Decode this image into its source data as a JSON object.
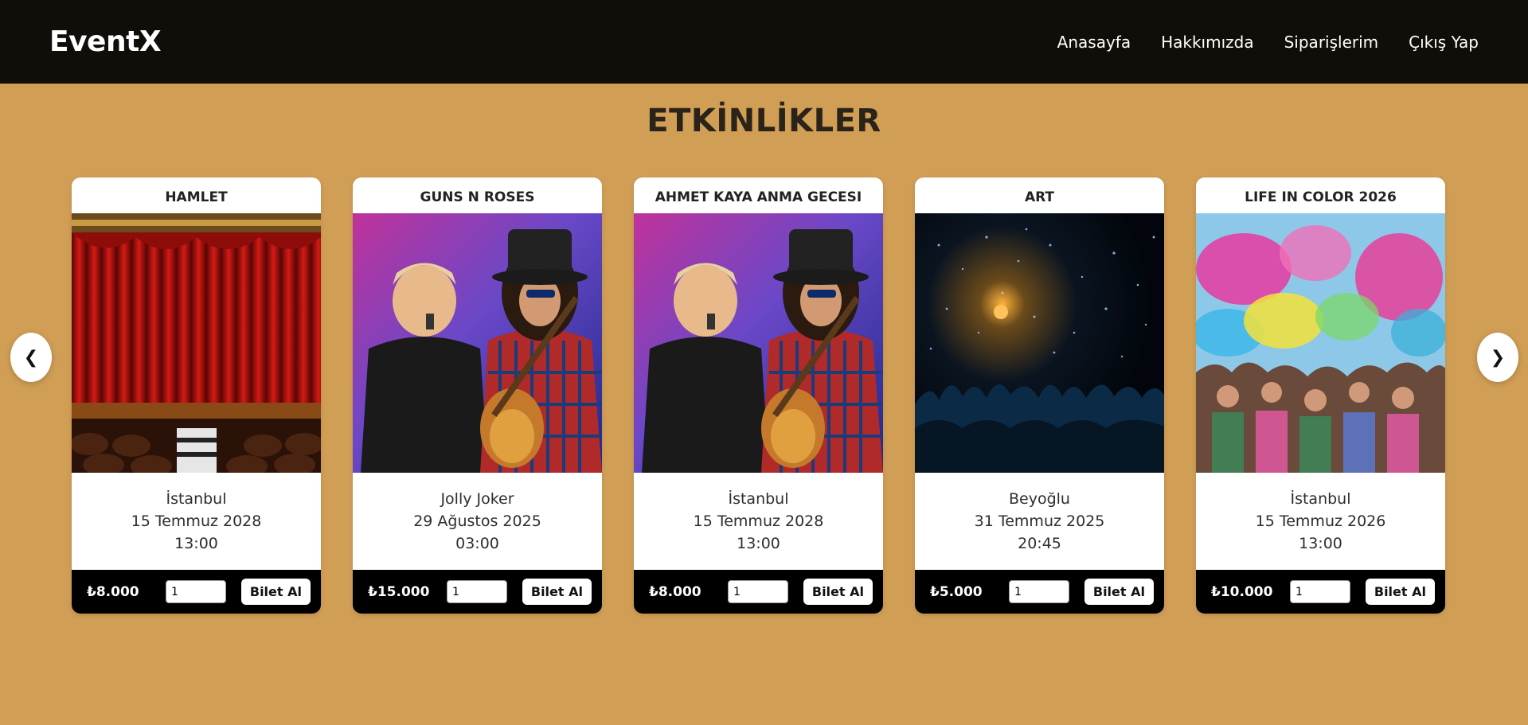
{
  "brand": "EventX",
  "nav": [
    "Anasayfa",
    "Hakkımızda",
    "Siparişlerim",
    "Çıkış Yap"
  ],
  "section_title": "ETKİNLİKLER",
  "carousel": {
    "prev": "❮",
    "next": "❯"
  },
  "buy_label": "Bilet Al",
  "events": [
    {
      "title": "HAMLET",
      "location": "İstanbul",
      "date": "15 Temmuz 2028",
      "time": "13:00",
      "price": "₺8.000",
      "qty": "1",
      "image": "theater-stage"
    },
    {
      "title": "GUNS N ROSES",
      "location": "Jolly Joker",
      "date": "29 Ağustos 2025",
      "time": "03:00",
      "price": "₺15.000",
      "qty": "1",
      "image": "rock-band"
    },
    {
      "title": "AHMET KAYA ANMA GECESI",
      "location": "İstanbul",
      "date": "15 Temmuz 2028",
      "time": "13:00",
      "price": "₺8.000",
      "qty": "1",
      "image": "rock-band"
    },
    {
      "title": "ART",
      "location": "Beyoğlu",
      "date": "31 Temmuz 2025",
      "time": "20:45",
      "price": "₺5.000",
      "qty": "1",
      "image": "concert-crowd"
    },
    {
      "title": "LIFE IN COLOR 2026",
      "location": "İstanbul",
      "date": "15 Temmuz 2026",
      "time": "13:00",
      "price": "₺10.000",
      "qty": "1",
      "image": "color-festival"
    }
  ]
}
